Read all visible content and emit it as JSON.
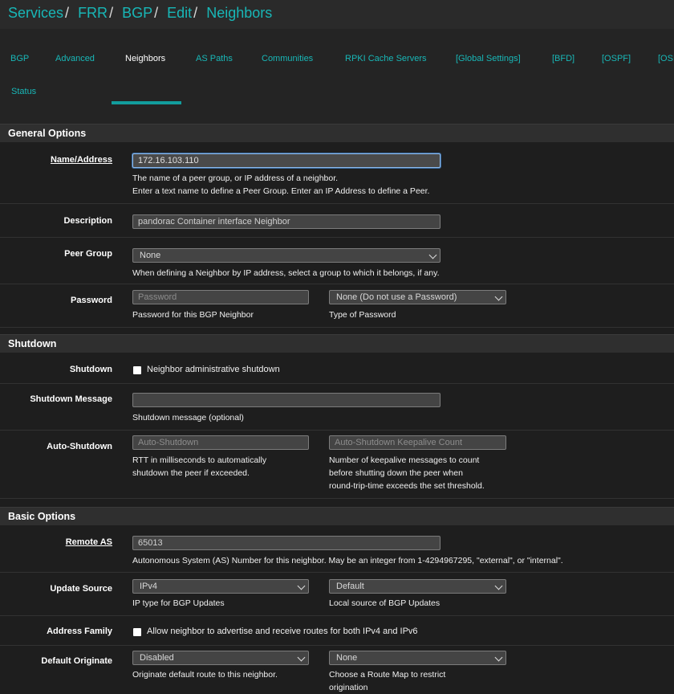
{
  "breadcrumb": [
    "Services",
    "FRR",
    "BGP",
    "Edit",
    "Neighbors"
  ],
  "tabs": [
    "BGP",
    "Advanced",
    "Neighbors",
    "AS Paths",
    "Communities",
    "RPKI Cache Servers",
    "[Global Settings]",
    "[BFD]",
    "[OSPF]",
    "[OSP"
  ],
  "tab_status": "Status",
  "sections": {
    "general": "General Options",
    "shutdown": "Shutdown",
    "basic": "Basic Options"
  },
  "name_address": {
    "label": "Name/Address",
    "value": "172.16.103.110",
    "help1": "The name of a peer group, or IP address of a neighbor.",
    "help2": "Enter a text name to define a Peer Group. Enter an IP Address to define a Peer."
  },
  "description": {
    "label": "Description",
    "value": "pandorac  Container interface Neighbor"
  },
  "peer_group": {
    "label": "Peer Group",
    "selected": "None",
    "help": "When defining a Neighbor by IP address, select a group to which it belongs, if any."
  },
  "password": {
    "label": "Password",
    "placeholder": "Password",
    "help": "Password for this BGP Neighbor",
    "type_selected": "None (Do not use a Password)",
    "type_help": "Type of Password"
  },
  "shutdown": {
    "label": "Shutdown",
    "checkbox": "Neighbor administrative shutdown"
  },
  "shutdown_message": {
    "label": "Shutdown Message",
    "value": "",
    "help": "Shutdown message (optional)"
  },
  "auto_shutdown": {
    "label": "Auto-Shutdown",
    "placeholder": "Auto-Shutdown",
    "help1": "RTT in milliseconds to automatically",
    "help2": "shutdown the peer if exceeded.",
    "keepalive_placeholder": "Auto-Shutdown Keepalive Count",
    "keepalive_help1": "Number of keepalive messages to count",
    "keepalive_help2": "before shutting down the peer when",
    "keepalive_help3": "round-trip-time exceeds the set threshold."
  },
  "remote_as": {
    "label": "Remote AS",
    "value": "65013",
    "help": "Autonomous System (AS) Number for this neighbor. May be an integer from 1-4294967295, \"external\", or \"internal\"."
  },
  "update_source": {
    "label": "Update Source",
    "selected": "IPv4",
    "help": "IP type for BGP Updates",
    "local_selected": "Default",
    "local_help": "Local source of BGP Updates"
  },
  "address_family": {
    "label": "Address Family",
    "checkbox": "Allow neighbor to advertise and receive routes for both IPv4 and IPv6"
  },
  "default_originate": {
    "label": "Default Originate",
    "selected": "Disabled",
    "help": "Originate default route to this neighbor.",
    "routemap_selected": "None",
    "routemap_help1": "Choose a Route Map to restrict",
    "routemap_help2": "origination"
  }
}
